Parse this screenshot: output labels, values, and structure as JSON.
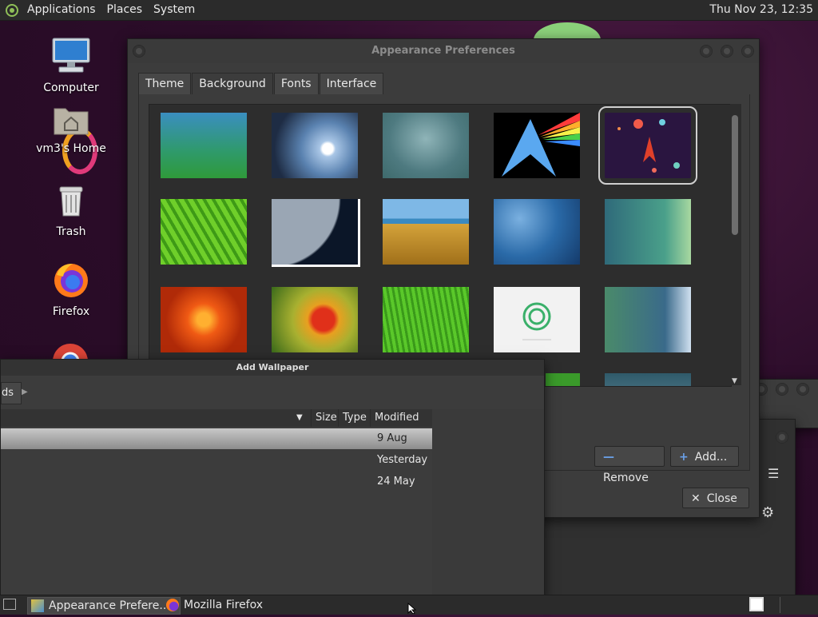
{
  "top_panel": {
    "menu_applications": "Applications",
    "menu_places": "Places",
    "menu_system": "System",
    "clock": "Thu Nov 23, 12:35"
  },
  "desktop": {
    "icons": [
      {
        "label": "Computer"
      },
      {
        "label": "vm3's Home"
      },
      {
        "label": "Trash"
      },
      {
        "label": "Firefox"
      }
    ]
  },
  "appearance": {
    "title": "Appearance Preferences",
    "tabs": [
      {
        "label": "Theme"
      },
      {
        "label": "Background"
      },
      {
        "label": "Fonts"
      },
      {
        "label": "Interface"
      }
    ],
    "active_tab": "Background",
    "remove_label": "Remove",
    "add_label": "Add...",
    "close_label": "Close",
    "thumbnails": [
      "gradient-blue-green",
      "water-drop",
      "teal-gradient",
      "arch-prism",
      "space-dots",
      "green-leaf",
      "earth-horizon",
      "beach-grass",
      "blue-bubbles",
      "teal-dots",
      "orange-flower",
      "red-flower",
      "green-grass",
      "white-logo",
      "blue-green-wave"
    ],
    "selected_index": 4
  },
  "add_wallpaper": {
    "title": "Add Wallpaper",
    "path_fragment": "ds",
    "columns": {
      "size": "Size",
      "type": "Type",
      "modified": "Modified"
    },
    "rows": [
      {
        "modified": "9 Aug"
      },
      {
        "modified": "Yesterday"
      },
      {
        "modified": "24 May"
      }
    ]
  },
  "taskbar": {
    "items": [
      {
        "label": "Appearance Prefere..."
      },
      {
        "label": "Mozilla Firefox"
      }
    ]
  },
  "colors": {
    "panel": "#2b2b2b",
    "window": "#3c3c3c",
    "accent_blue": "#4a7bd0"
  }
}
